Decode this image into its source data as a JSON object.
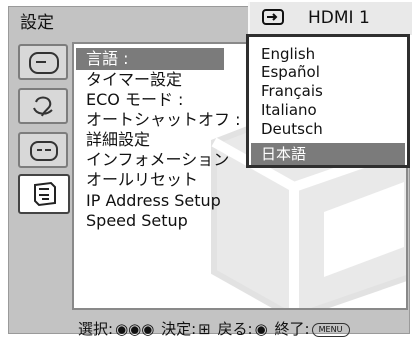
{
  "window": {
    "title": "設定",
    "input_source": "HDMI 1"
  },
  "sidebar": {
    "tabs": [
      {
        "name": "picture-settings",
        "icon": "monitor-icon"
      },
      {
        "name": "sound-settings",
        "icon": "speaker-icon"
      },
      {
        "name": "display-settings",
        "icon": "screen-icon"
      },
      {
        "name": "setup",
        "icon": "gear-box-icon"
      }
    ]
  },
  "menu": {
    "items": [
      {
        "label": "言語 :"
      },
      {
        "label": "タイマー設定"
      },
      {
        "label": "ECO モード :"
      },
      {
        "label": "オートシャットオフ :"
      },
      {
        "label": "詳細設定"
      },
      {
        "label": "インフォメーション"
      },
      {
        "label": "オールリセット"
      },
      {
        "label": "IP Address Setup"
      },
      {
        "label": "Speed Setup"
      }
    ]
  },
  "language_dropdown": {
    "options": [
      "English",
      "Español",
      "Français",
      "Italiano",
      "Deutsch",
      "日本語"
    ],
    "selected": "日本語"
  },
  "footer": {
    "select": "選択:",
    "confirm": "決定:",
    "back": "戻る:",
    "exit": "終了:",
    "menu_button": "MENU"
  }
}
